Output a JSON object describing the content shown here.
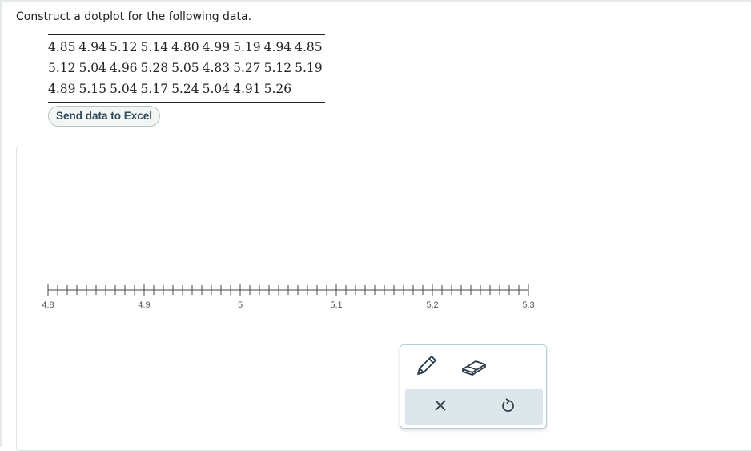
{
  "prompt": "Construct a dotplot for the following data.",
  "data_rows": [
    [
      "4.85",
      "4.94",
      "5.12",
      "5.14",
      "4.80",
      "4.99",
      "5.19",
      "4.94",
      "4.85"
    ],
    [
      "5.12",
      "5.04",
      "4.96",
      "5.28",
      "5.05",
      "4.83",
      "5.27",
      "5.12",
      "5.19"
    ],
    [
      "4.89",
      "5.15",
      "5.04",
      "5.17",
      "5.24",
      "5.04",
      "4.91",
      "5.26"
    ]
  ],
  "excel_button_label": "Send data to Excel",
  "number_line": {
    "min": 4.8,
    "max": 5.3,
    "minor_step": 0.01,
    "major_step": 0.1,
    "major_labels": [
      "4.8",
      "4.9",
      "5",
      "5.1",
      "5.2",
      "5.3"
    ]
  },
  "toolbox": {
    "tools": [
      "pencil-icon",
      "eraser-icon"
    ],
    "actions": [
      "clear-icon",
      "undo-icon"
    ]
  },
  "colors": {
    "axis": "#444444",
    "button_text": "#2f4a5a",
    "toolbar_bg": "#dde6ea"
  }
}
